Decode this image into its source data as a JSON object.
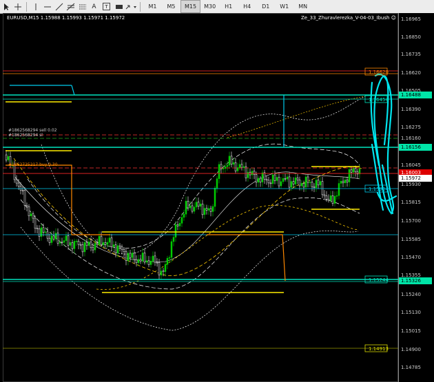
{
  "toolbar": {
    "tools": [
      "cursor-icon",
      "crosshair-icon",
      "vertical-line-icon",
      "horizontal-line-icon",
      "trendline-icon",
      "fibonacci-icon",
      "channel-icon",
      "text-icon",
      "label-icon",
      "rectangle-icon",
      "arrows-icon"
    ],
    "text_tool": "A",
    "label_tool": "T",
    "timeframes": [
      "M1",
      "M5",
      "M15",
      "M30",
      "H1",
      "H4",
      "D1",
      "W1",
      "MN"
    ],
    "active_timeframe": "M15"
  },
  "chart": {
    "header": "EURUSD,M15  1.15988 1.15993 1.15971 1.15972",
    "indicator_label": "Ze_33_Zhuravlerezka_V-04-03_Ibush",
    "orders": [
      "#1862568294 sell 0.02",
      "#1862568294 sl",
      "#1862725217 buy 0.30"
    ],
    "levels": [
      "1.16620",
      "1.16454",
      "1.15904",
      "1.15244",
      "1.14913"
    ],
    "colors": {
      "bull": "#00cc00",
      "bear": "#ffffff",
      "support": "#ffcc00",
      "resistance": "#ff8800",
      "cyan": "#00e5ee",
      "red": "#ff3333"
    }
  },
  "price_axis": {
    "labels": [
      "1.16965",
      "1.16850",
      "1.16735",
      "1.16620",
      "1.16505",
      "1.16390",
      "1.16275",
      "1.16160",
      "1.16045",
      "1.15930",
      "1.15815",
      "1.15700",
      "1.15585",
      "1.15470",
      "1.15355",
      "1.15240",
      "1.15130",
      "1.15015",
      "1.14900",
      "1.14785"
    ],
    "tags": [
      {
        "text": "1.16488",
        "bg": "#00e5a8",
        "fg": "#000000"
      },
      {
        "text": "1.16156",
        "bg": "#00e5a8",
        "fg": "#000000"
      },
      {
        "text": "1.16003",
        "bg": "#dd0000",
        "fg": "#ffffff"
      },
      {
        "text": "1.15972",
        "bg": "#ffffff",
        "fg": "#000000"
      },
      {
        "text": "1.15326",
        "bg": "#00e5a8",
        "fg": "#000000"
      }
    ]
  }
}
